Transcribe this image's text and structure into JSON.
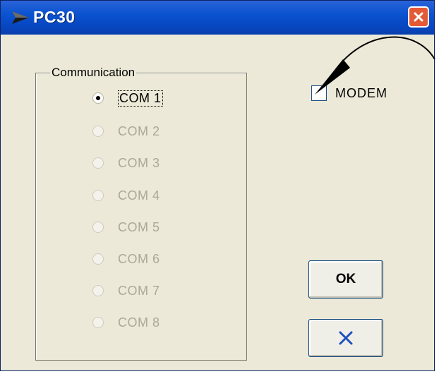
{
  "window": {
    "title": "PC30"
  },
  "communication": {
    "label": "Communication",
    "ports": [
      {
        "label": "COM 1",
        "selected": true,
        "enabled": true
      },
      {
        "label": "COM 2",
        "selected": false,
        "enabled": false
      },
      {
        "label": "COM 3",
        "selected": false,
        "enabled": false
      },
      {
        "label": "COM 4",
        "selected": false,
        "enabled": false
      },
      {
        "label": "COM 5",
        "selected": false,
        "enabled": false
      },
      {
        "label": "COM 6",
        "selected": false,
        "enabled": false
      },
      {
        "label": "COM 7",
        "selected": false,
        "enabled": false
      },
      {
        "label": "COM 8",
        "selected": false,
        "enabled": false
      }
    ]
  },
  "modem": {
    "label": "MODEM",
    "checked": false
  },
  "buttons": {
    "ok_label": "OK",
    "cancel_icon": "x-cancel-icon"
  },
  "colors": {
    "titlebar": "#0a53d0",
    "close_button": "#e45a37",
    "dialog_bg": "#ece9d8",
    "cancel_x": "#1f4fbf"
  }
}
